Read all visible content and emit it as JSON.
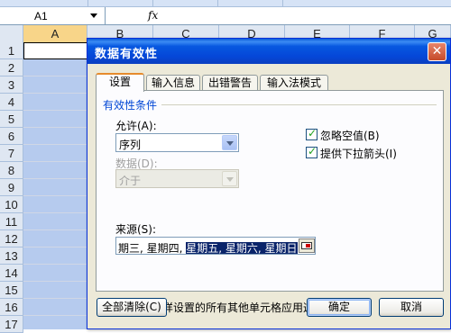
{
  "excel": {
    "namebox": "A1",
    "fx_label": "fx",
    "columns": [
      "A",
      "B",
      "C",
      "D",
      "E",
      "F",
      "G"
    ],
    "rows": [
      "1",
      "2",
      "3",
      "4",
      "5",
      "6",
      "7",
      "8",
      "9",
      "10",
      "11",
      "12",
      "13",
      "14",
      "15",
      "16",
      "17"
    ],
    "selection_color": "#b6cbee"
  },
  "dialog": {
    "title": "数据有效性",
    "tabs": [
      "设置",
      "输入信息",
      "出错警告",
      "输入法模式"
    ],
    "group_title": "有效性条件",
    "allow": {
      "label": "允许(A):",
      "value": "序列"
    },
    "data": {
      "label": "数据(D):",
      "value": "介于"
    },
    "source": {
      "label": "来源(S):",
      "value_plain": "期三, 星期四, ",
      "value_selected": "星期五, 星期六, 星期日"
    },
    "ignore_blank": {
      "label": "忽略空值(B)",
      "checked": true
    },
    "dropdown": {
      "label": "提供下拉箭头(I)",
      "checked": true
    },
    "apply_all": {
      "label": "对有同样设置的所有其他单元格应用这些更改(P)",
      "checked": false
    },
    "buttons": {
      "clear_all": "全部清除(C)",
      "ok": "确定",
      "cancel": "取消"
    }
  }
}
